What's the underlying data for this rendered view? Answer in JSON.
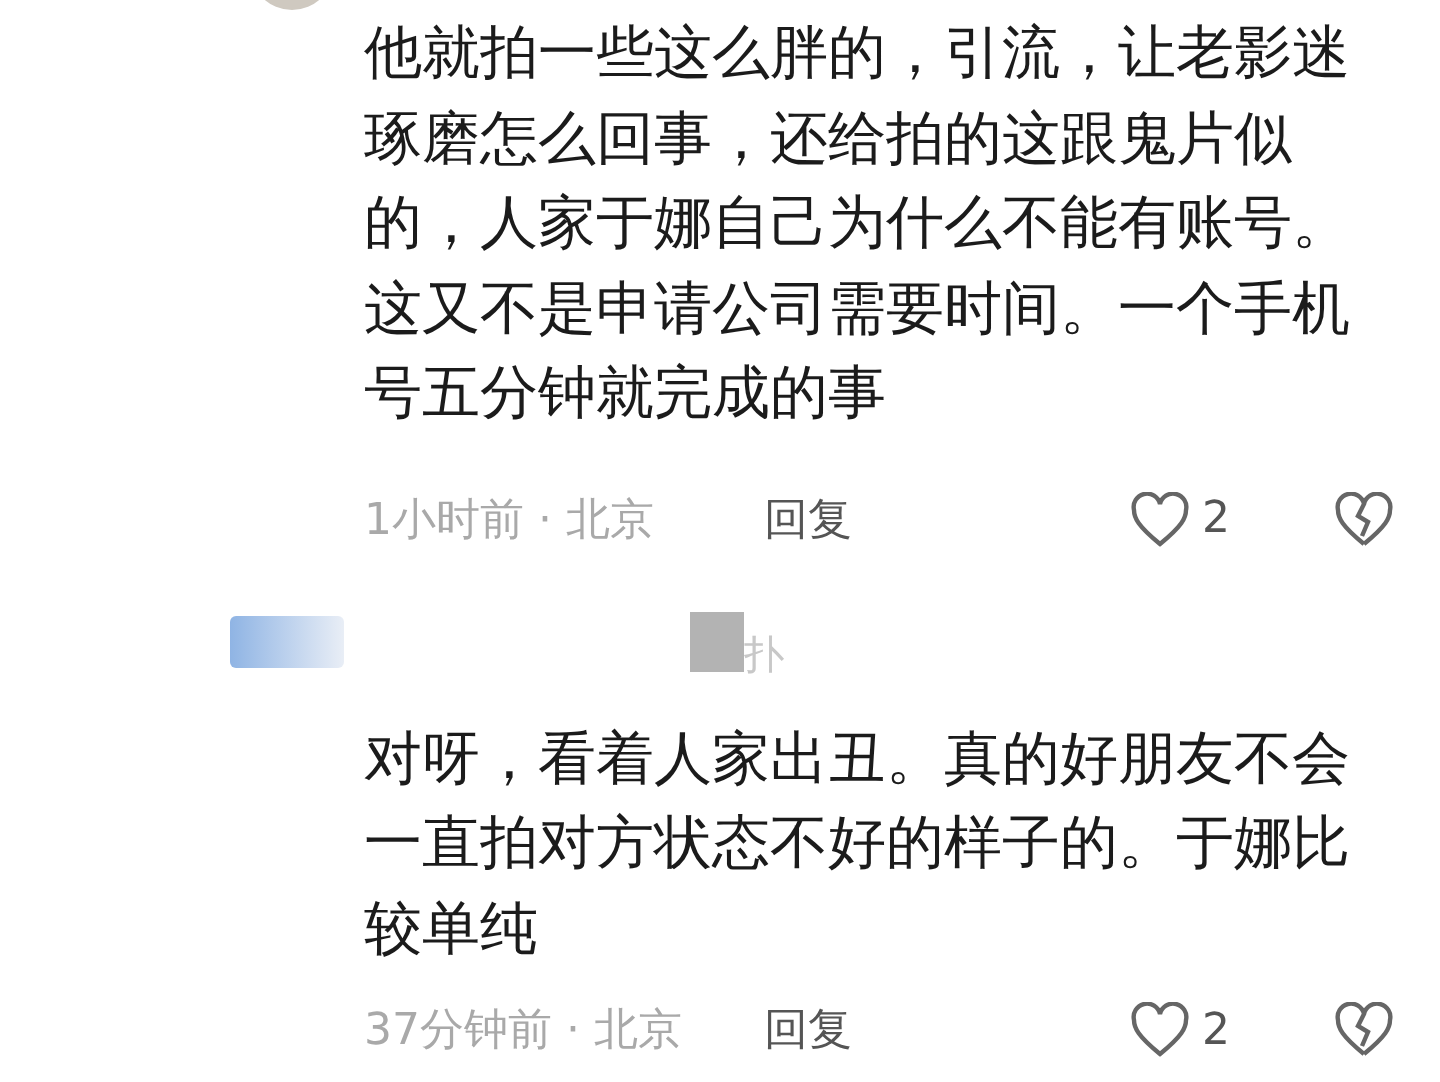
{
  "comments": [
    {
      "text": "他就拍一些这么胖的，引流，让老影迷琢磨怎么回事，还给拍的这跟鬼片似的，人家于娜自己为什么不能有账号。这又不是申请公司需要时间。一个手机号五分钟就完成的事",
      "time": "1小时前 · 北京",
      "reply": "回复",
      "likes": "2"
    },
    {
      "username": "扑",
      "text": "对呀，看着人家出丑。真的好朋友不会一直拍对方状态不好的样子的。于娜比较单纯",
      "time": "37分钟前 · 北京",
      "reply": "回复",
      "likes": "2"
    }
  ]
}
